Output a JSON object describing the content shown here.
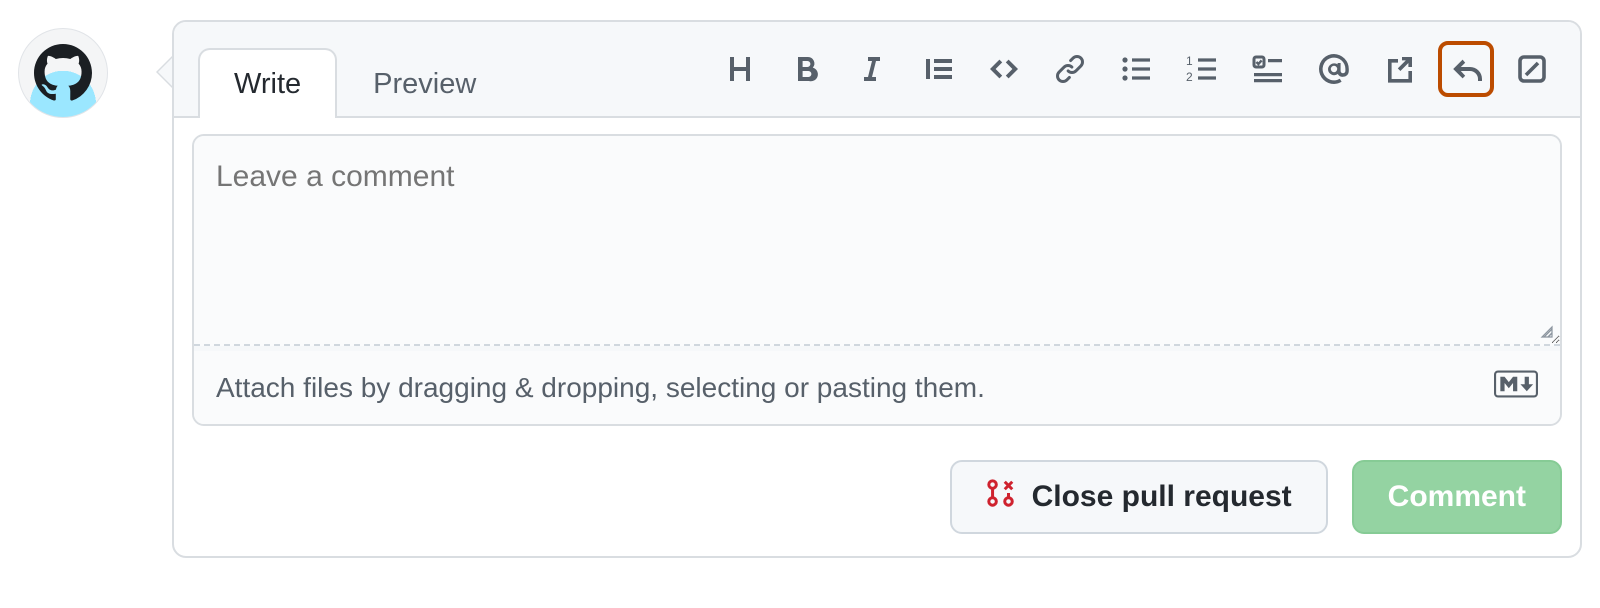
{
  "tabs": {
    "write": "Write",
    "preview": "Preview",
    "active": "write"
  },
  "toolbar": {
    "heading": "heading-icon",
    "bold": "bold-icon",
    "italic": "italic-icon",
    "quote": "quote-icon",
    "code": "code-icon",
    "link": "link-icon",
    "ul": "unordered-list-icon",
    "ol": "ordered-list-icon",
    "task": "task-list-icon",
    "mention": "mention-icon",
    "crossref": "crossref-icon",
    "reply": "reply-icon",
    "suggest": "suggest-edit-icon"
  },
  "editor": {
    "placeholder": "Leave a comment",
    "value": "",
    "attach_hint": "Attach files by dragging & dropping, selecting or pasting them."
  },
  "buttons": {
    "close": "Close pull request",
    "comment": "Comment"
  }
}
